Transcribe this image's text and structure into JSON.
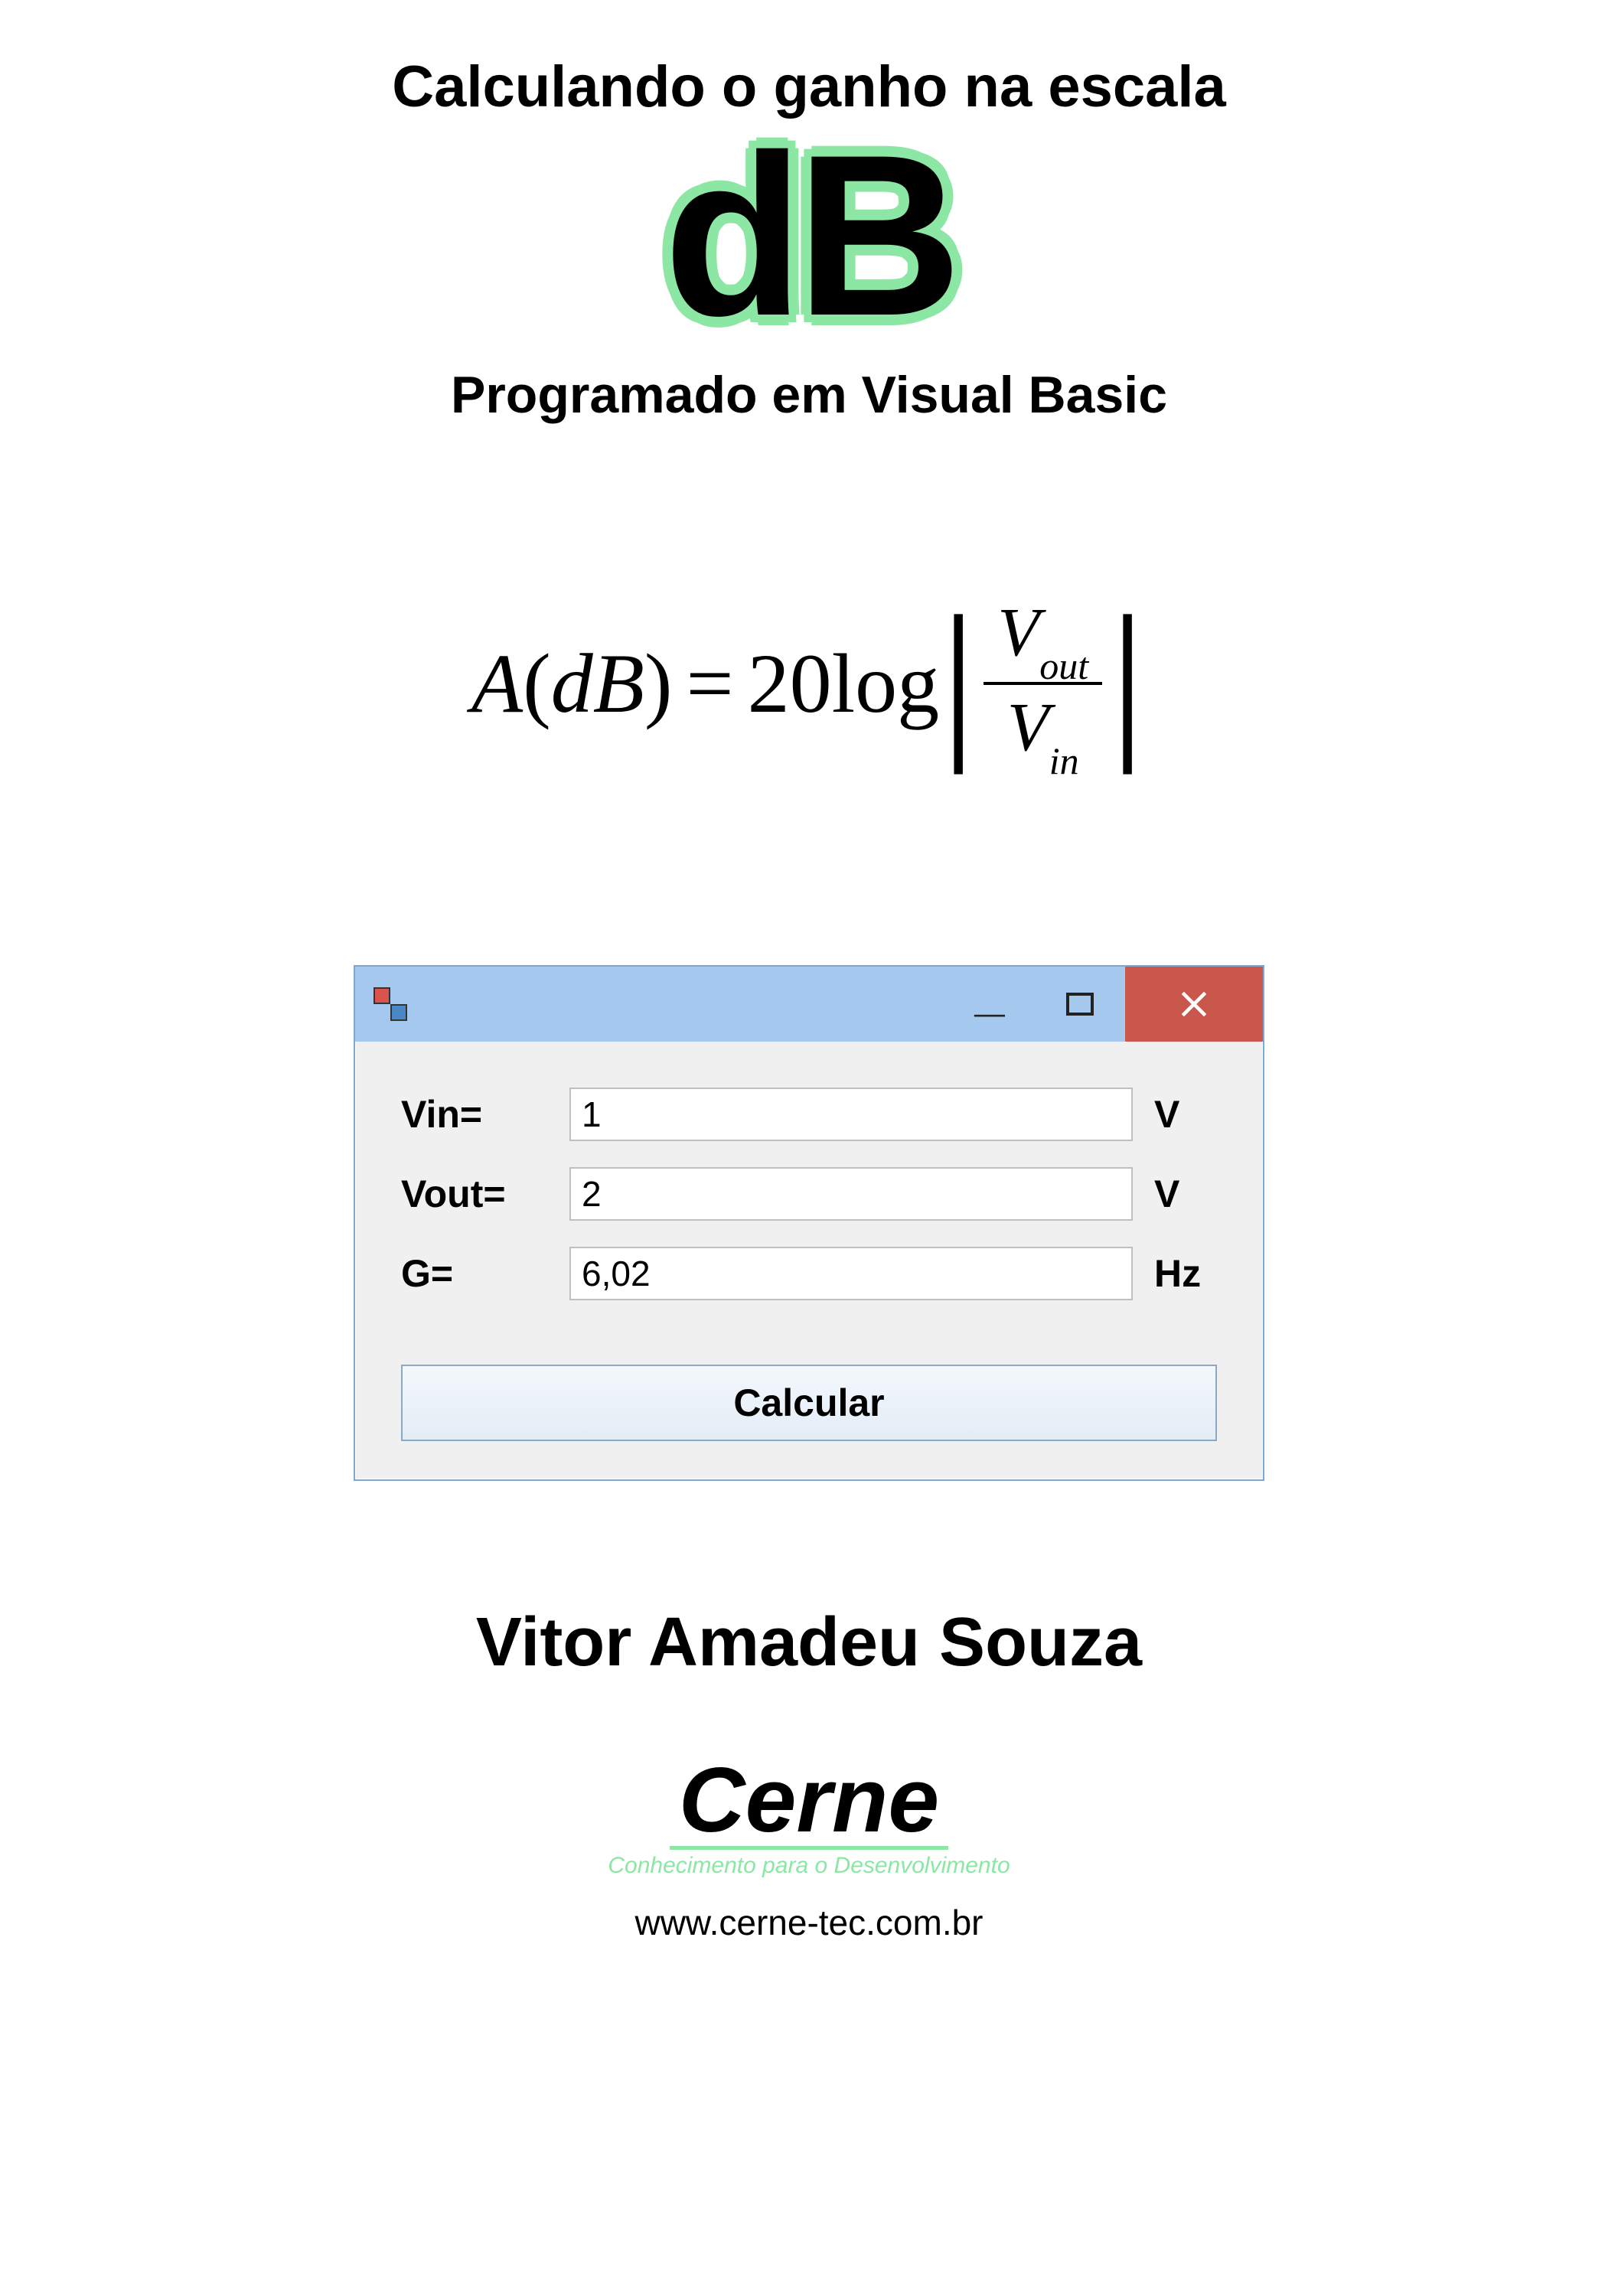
{
  "header": {
    "title_top": "Calculando o ganho na escala",
    "logo_text": "dB",
    "subtitle": "Programado em Visual Basic"
  },
  "formula": {
    "lhs_var": "A",
    "lhs_unit": "dB",
    "coeff": "20",
    "func": "log",
    "num_var": "V",
    "num_sub": "out",
    "den_var": "V",
    "den_sub": "in"
  },
  "window": {
    "rows": [
      {
        "label": "Vin=",
        "value": "1",
        "unit": "V"
      },
      {
        "label": "Vout=",
        "value": "2",
        "unit": "V"
      },
      {
        "label": "G=",
        "value": "6,02",
        "unit": "Hz"
      }
    ],
    "button": "Calcular"
  },
  "author": "Vitor Amadeu Souza",
  "company": {
    "name": "Cerne",
    "tagline": "Conhecimento para o Desenvolvimento",
    "url": "www.cerne-tec.com.br"
  }
}
